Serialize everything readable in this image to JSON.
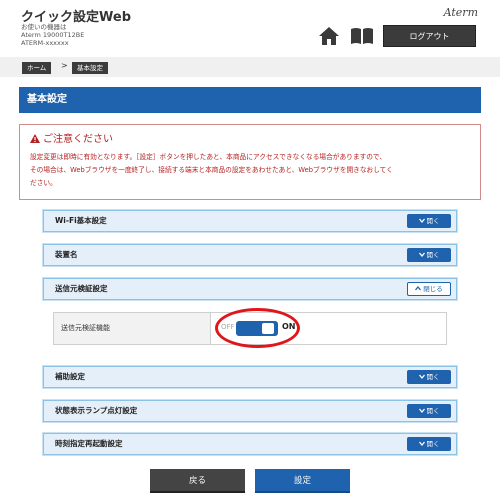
{
  "header": {
    "title": "クイック設定Web",
    "sublines": [
      "お使いの機器は",
      "Aterm 19000T12BE",
      "ATERM-xxxxxx"
    ],
    "brand": "Aterm",
    "logout_label": "ログアウト"
  },
  "breadcrumb": {
    "home": "ホーム",
    "separator": ">",
    "current": "基本設定"
  },
  "page_title": "基本設定",
  "notice": {
    "title": "ご注意ください",
    "lines": [
      "設定変更は即時に有効となります。［設定］ボタンを押したあと、本商品にアクセスできなくなる場合がありますので、",
      "その場合は、Webブラウザを一度終了し、接続する端末と本商品の設定をあわせたあと、Webブラウザを開きなおしてく",
      "ださい。"
    ]
  },
  "sections": [
    {
      "label": "Wi-Fi基本設定",
      "button": "開く"
    },
    {
      "label": "装置名",
      "button": "開く"
    },
    {
      "label": "送信元検証設定",
      "button": "閉じる"
    },
    {
      "label": "補助設定",
      "button": "開く"
    },
    {
      "label": "状態表示ランプ点灯設定",
      "button": "開く"
    },
    {
      "label": "時刻指定再起動設定",
      "button": "開く"
    }
  ],
  "source_verify": {
    "label": "送信元検証機能",
    "off_text": "OFF",
    "on_text": "ON",
    "state": "ON"
  },
  "buttons": {
    "back": "戻る",
    "apply": "設定"
  },
  "colors": {
    "accent": "#1f62ad",
    "notice": "#b41f1f",
    "highlight": "#e0161b"
  }
}
